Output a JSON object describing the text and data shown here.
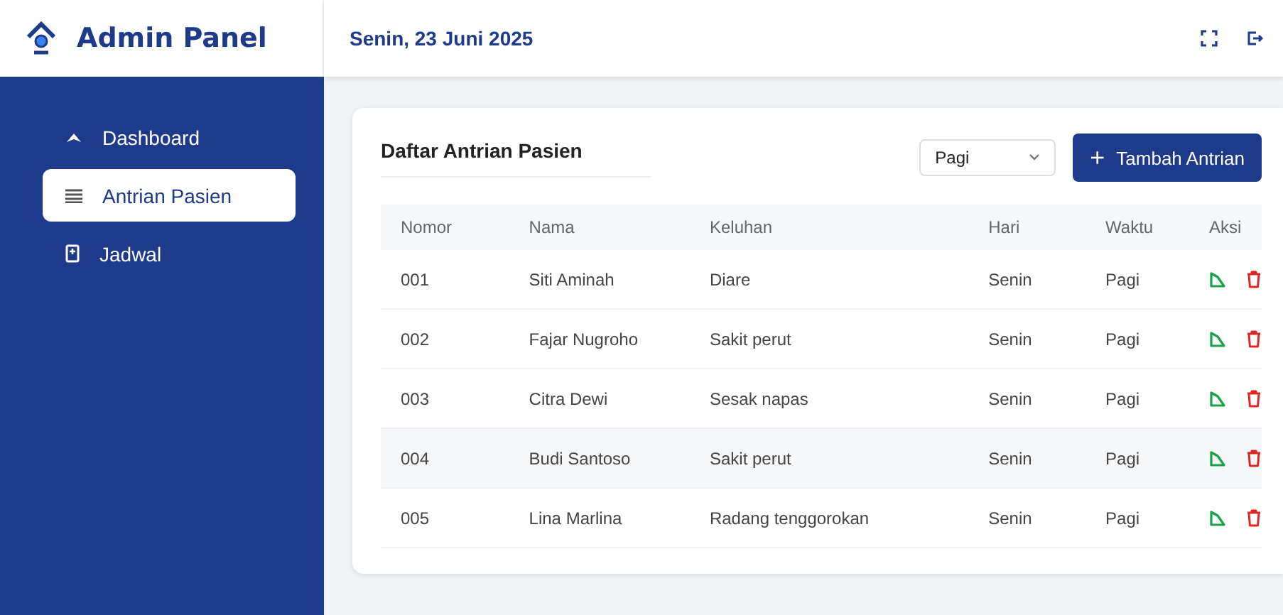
{
  "brand": {
    "title": "Admin Panel"
  },
  "header": {
    "date": "Senin, 23 Juni 2025"
  },
  "sidebar": {
    "items": [
      {
        "label": "Dashboard",
        "selected": false
      },
      {
        "label": "Antrian Pasien",
        "selected": true
      },
      {
        "label": "Jadwal",
        "selected": false
      }
    ]
  },
  "card": {
    "title": "Daftar Antrian Pasien",
    "filter": {
      "value": "Pagi"
    },
    "add_button": {
      "icon": "+",
      "label": "Tambah Antrian"
    }
  },
  "table": {
    "columns": [
      "Nomor",
      "Nama",
      "Keluhan",
      "Hari",
      "Waktu",
      "Aksi"
    ],
    "rows": [
      {
        "nomor": "001",
        "nama": "Siti Aminah",
        "keluhan": "Diare",
        "hari": "Senin",
        "waktu": "Pagi"
      },
      {
        "nomor": "002",
        "nama": "Fajar Nugroho",
        "keluhan": "Sakit perut",
        "hari": "Senin",
        "waktu": "Pagi"
      },
      {
        "nomor": "003",
        "nama": "Citra Dewi",
        "keluhan": "Sesak napas",
        "hari": "Senin",
        "waktu": "Pagi"
      },
      {
        "nomor": "004",
        "nama": "Budi Santoso",
        "keluhan": "Sakit perut",
        "hari": "Senin",
        "waktu": "Pagi"
      },
      {
        "nomor": "005",
        "nama": "Lina Marlina",
        "keluhan": "Radang tenggorokan",
        "hari": "Senin",
        "waktu": "Pagi"
      }
    ]
  }
}
